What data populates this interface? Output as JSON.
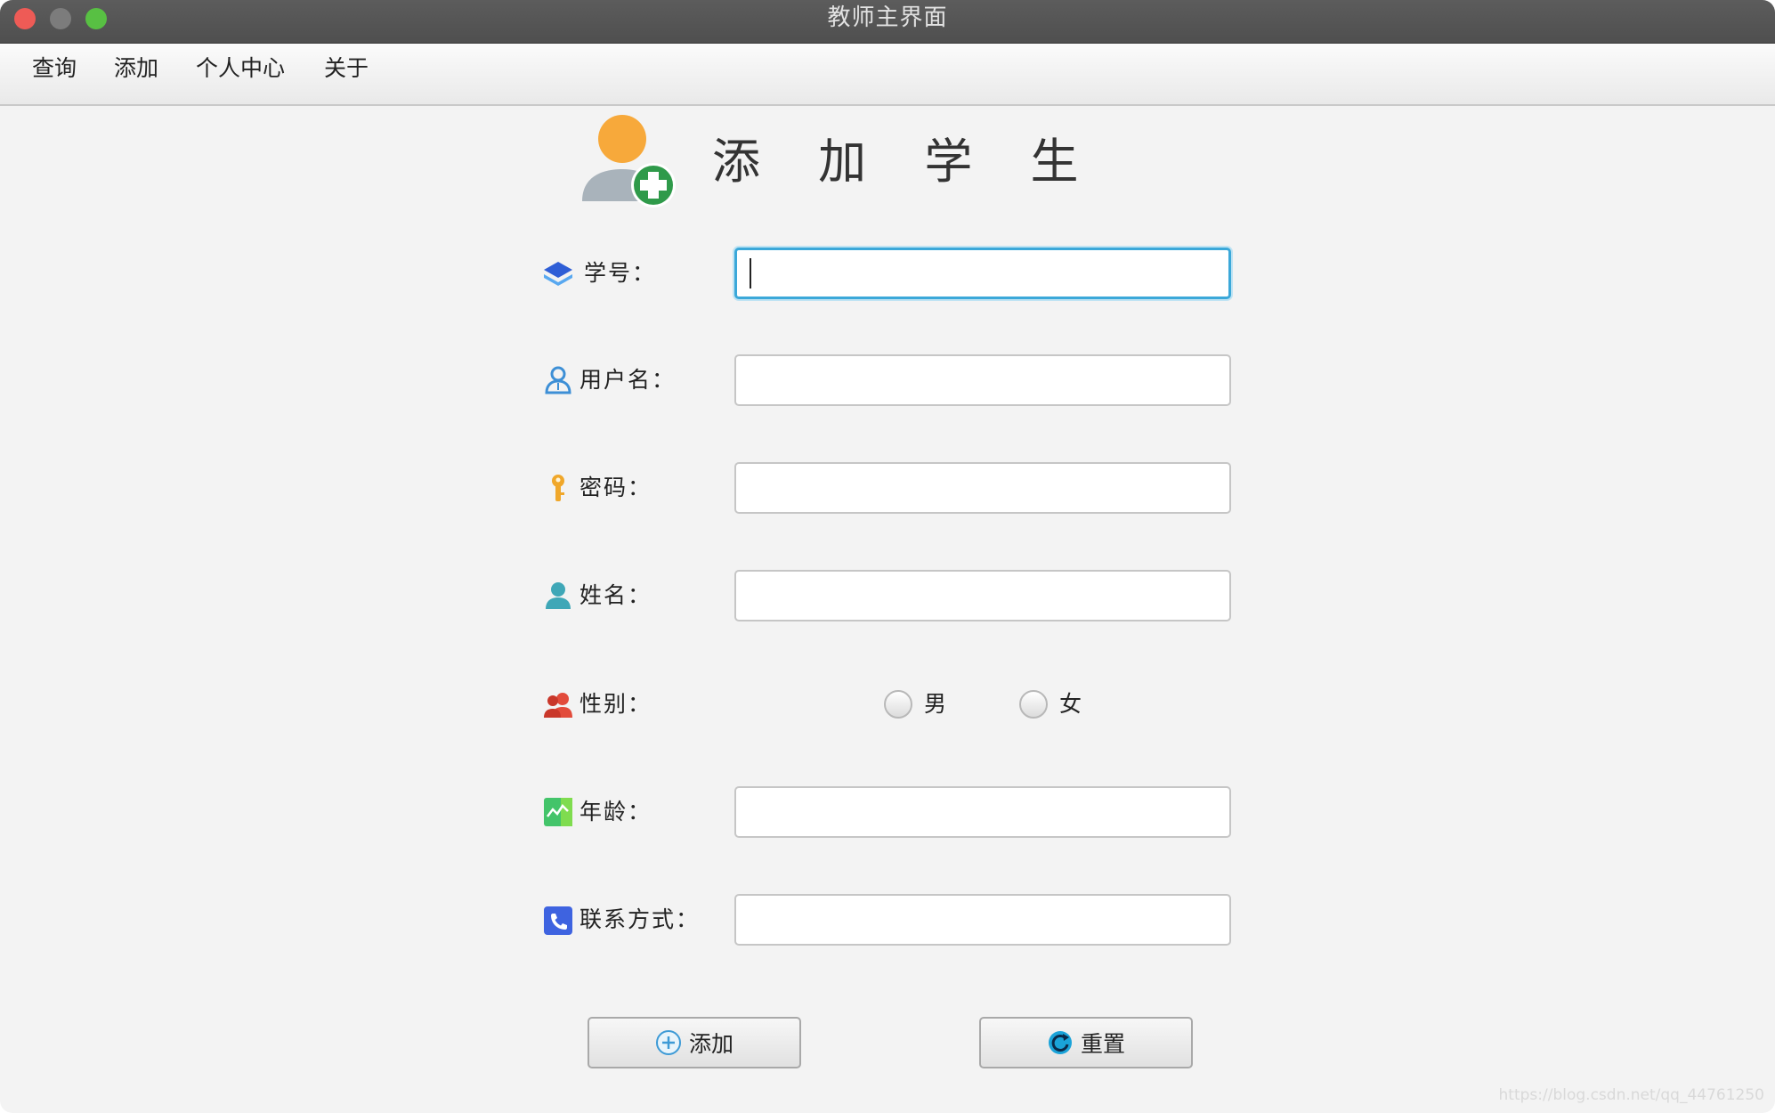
{
  "window": {
    "title": "教师主界面"
  },
  "menu": {
    "items": [
      "查询",
      "添加",
      "个人中心",
      "关于"
    ]
  },
  "header": {
    "title": "添 加 学 生",
    "icon": "add-user-icon"
  },
  "form": {
    "student_id_label": "学号：",
    "username_label": "用户名：",
    "password_label": "密码：",
    "name_label": "姓名：",
    "gender_label": "性别：",
    "gender_options": [
      "男",
      "女"
    ],
    "age_label": "年龄：",
    "contact_label": "联系方式：",
    "student_id_value": "",
    "username_value": "",
    "password_value": "",
    "name_value": "",
    "age_value": "",
    "contact_value": ""
  },
  "buttons": {
    "add_label": "添加",
    "reset_label": "重置"
  },
  "watermark": "https://blog.csdn.net/qq_44761250",
  "colors": {
    "titlebar": "#555555",
    "focus_border": "#3ba8d9",
    "window_bg": "#f3f3f3"
  }
}
